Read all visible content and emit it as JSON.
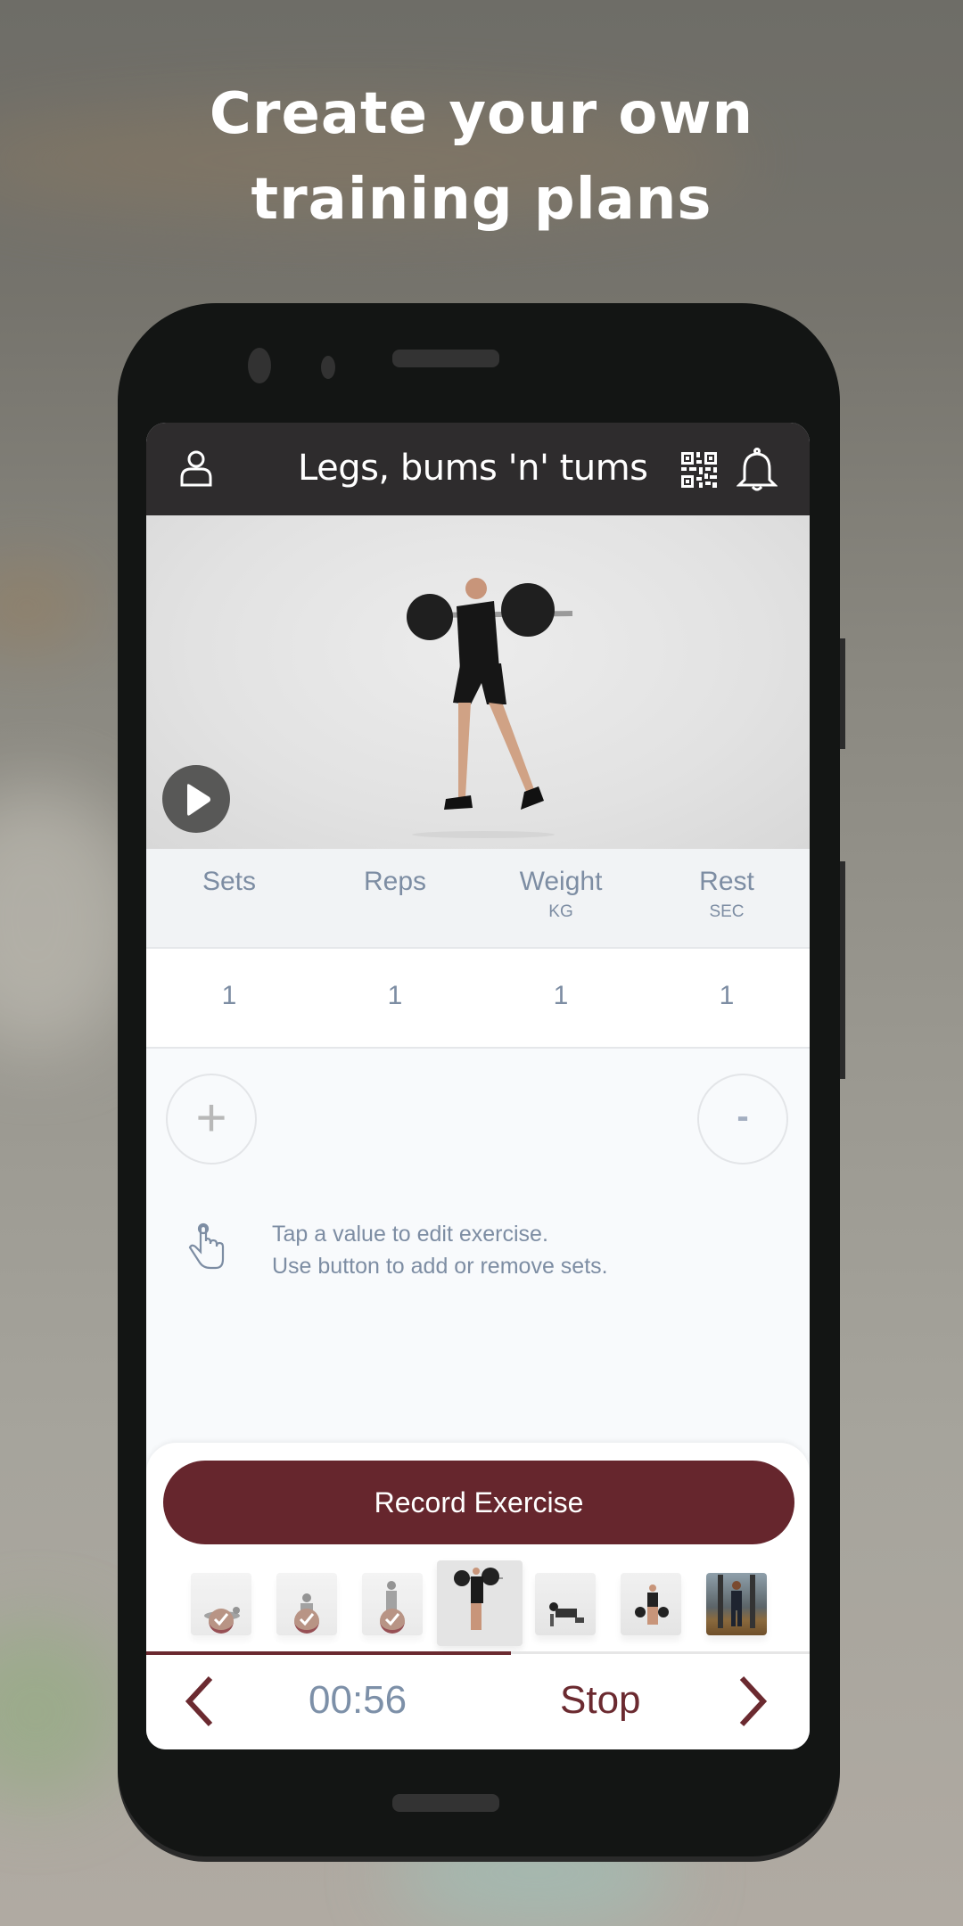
{
  "promo": {
    "headline_line1": "Create your own",
    "headline_line2": "training plans"
  },
  "app": {
    "header": {
      "title": "Legs, bums 'n' tums",
      "left_icon": "user-icon",
      "right_icons": [
        "qr-code-icon",
        "bell-icon"
      ]
    },
    "video": {
      "play_icon": "play-icon"
    },
    "table": {
      "columns": [
        {
          "label": "Sets",
          "unit": ""
        },
        {
          "label": "Reps",
          "unit": ""
        },
        {
          "label": "Weight",
          "unit": "KG"
        },
        {
          "label": "Rest",
          "unit": "SEC"
        }
      ],
      "rows": [
        [
          "1",
          "1",
          "1",
          "1"
        ]
      ]
    },
    "controls": {
      "add_label": "+",
      "remove_label": "-"
    },
    "hint": {
      "icon": "tap-hand-icon",
      "line1": "Tap a value to edit exercise.",
      "line2": "Use button to add or remove sets."
    },
    "bottom": {
      "record_label": "Record Exercise",
      "exercises": [
        {
          "name": "exercise-1",
          "status": "completed"
        },
        {
          "name": "exercise-2",
          "status": "completed"
        },
        {
          "name": "exercise-3",
          "status": "completed"
        },
        {
          "name": "exercise-4",
          "status": "current"
        },
        {
          "name": "exercise-5",
          "status": "upcoming"
        },
        {
          "name": "exercise-6",
          "status": "upcoming"
        },
        {
          "name": "exercise-7",
          "status": "upcoming"
        }
      ],
      "progress_fraction": 0.55,
      "timer": "00:56",
      "stop_label": "Stop"
    },
    "colors": {
      "accent": "#66262d",
      "header_bg": "#2e2c2d",
      "muted_text": "#7d8da3",
      "check_badge": "#a57763"
    }
  }
}
